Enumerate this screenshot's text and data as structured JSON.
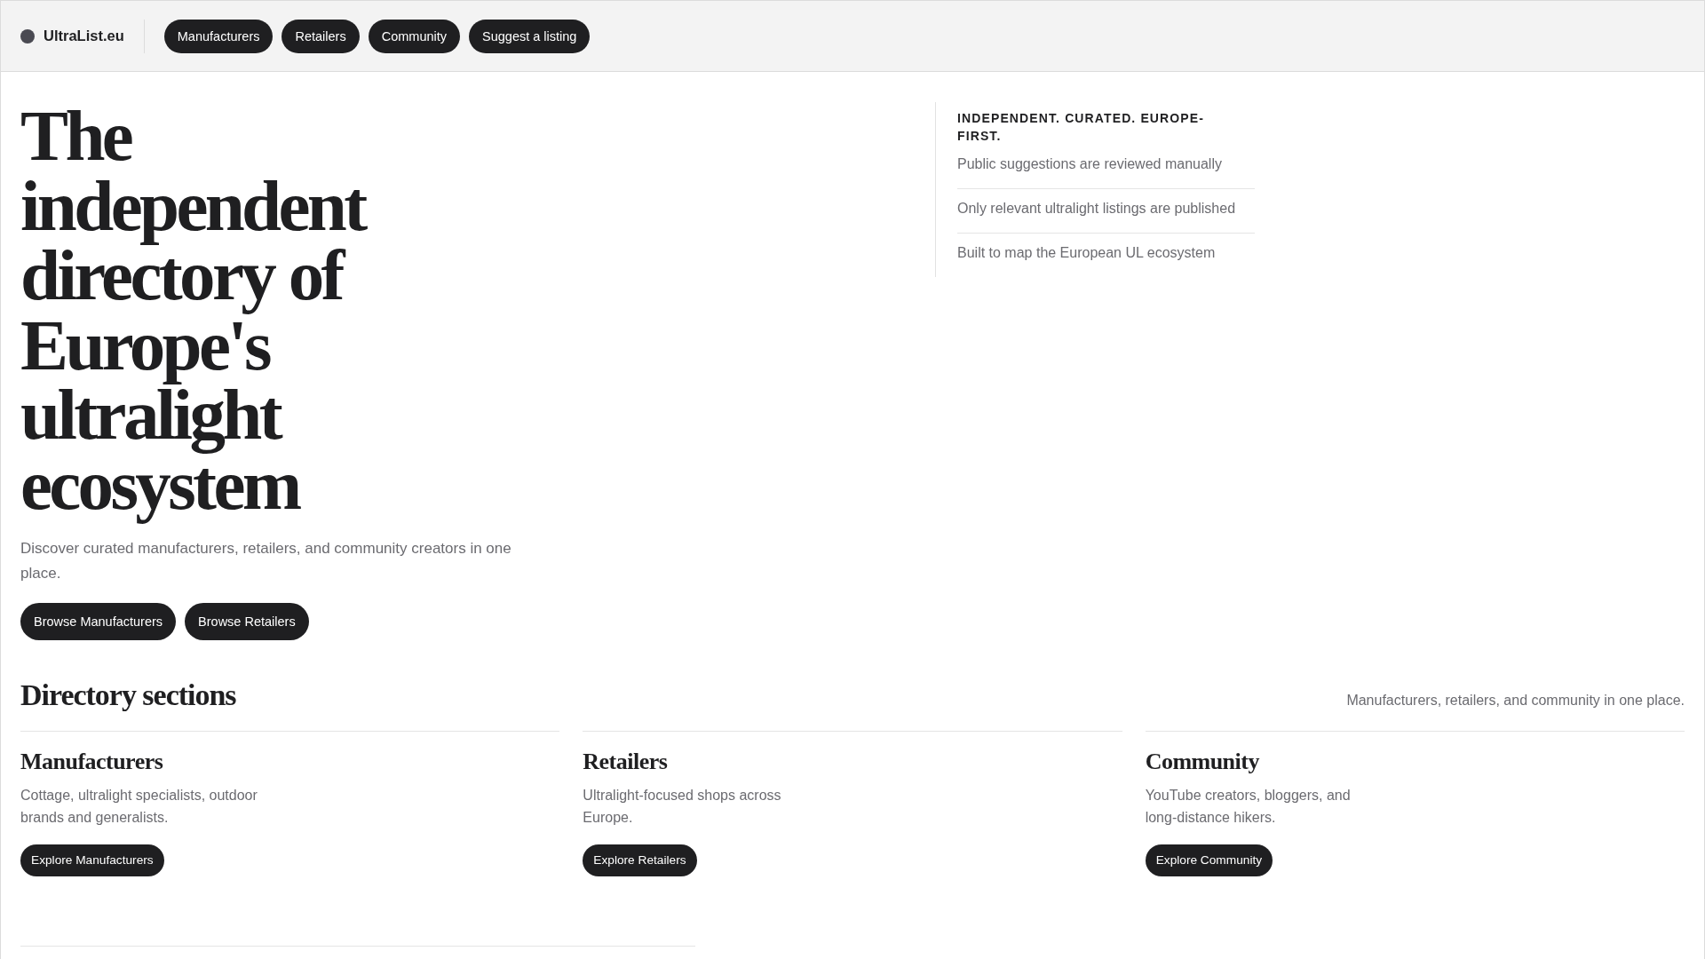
{
  "header": {
    "logo": "UltraList.eu",
    "nav": [
      "Manufacturers",
      "Retailers",
      "Community",
      "Suggest a listing"
    ]
  },
  "hero": {
    "title": "The independent directory of Europe's ultralight ecosystem",
    "subtitle": "Discover curated manufacturers, retailers, and community creators in one place.",
    "buttons": [
      "Browse Manufacturers",
      "Browse Retailers"
    ]
  },
  "highlights": {
    "title": "INDEPENDENT. CURATED. EUROPE-FIRST.",
    "items": [
      "Public suggestions are reviewed manually",
      "Only relevant ultralight listings are published",
      "Built to map the European UL ecosystem"
    ]
  },
  "directory": {
    "title": "Directory sections",
    "summary": "Manufacturers, retailers, and community in one place.",
    "sections": [
      {
        "title": "Manufacturers",
        "description": "Cottage, ultralight specialists, outdoor brands and generalists.",
        "button": "Explore Manufacturers"
      },
      {
        "title": "Retailers",
        "description": "Ultralight-focused shops across Europe.",
        "button": "Explore Retailers"
      },
      {
        "title": "Community",
        "description": "YouTube creators, bloggers, and long-distance hikers.",
        "button": "Explore Community"
      }
    ]
  }
}
